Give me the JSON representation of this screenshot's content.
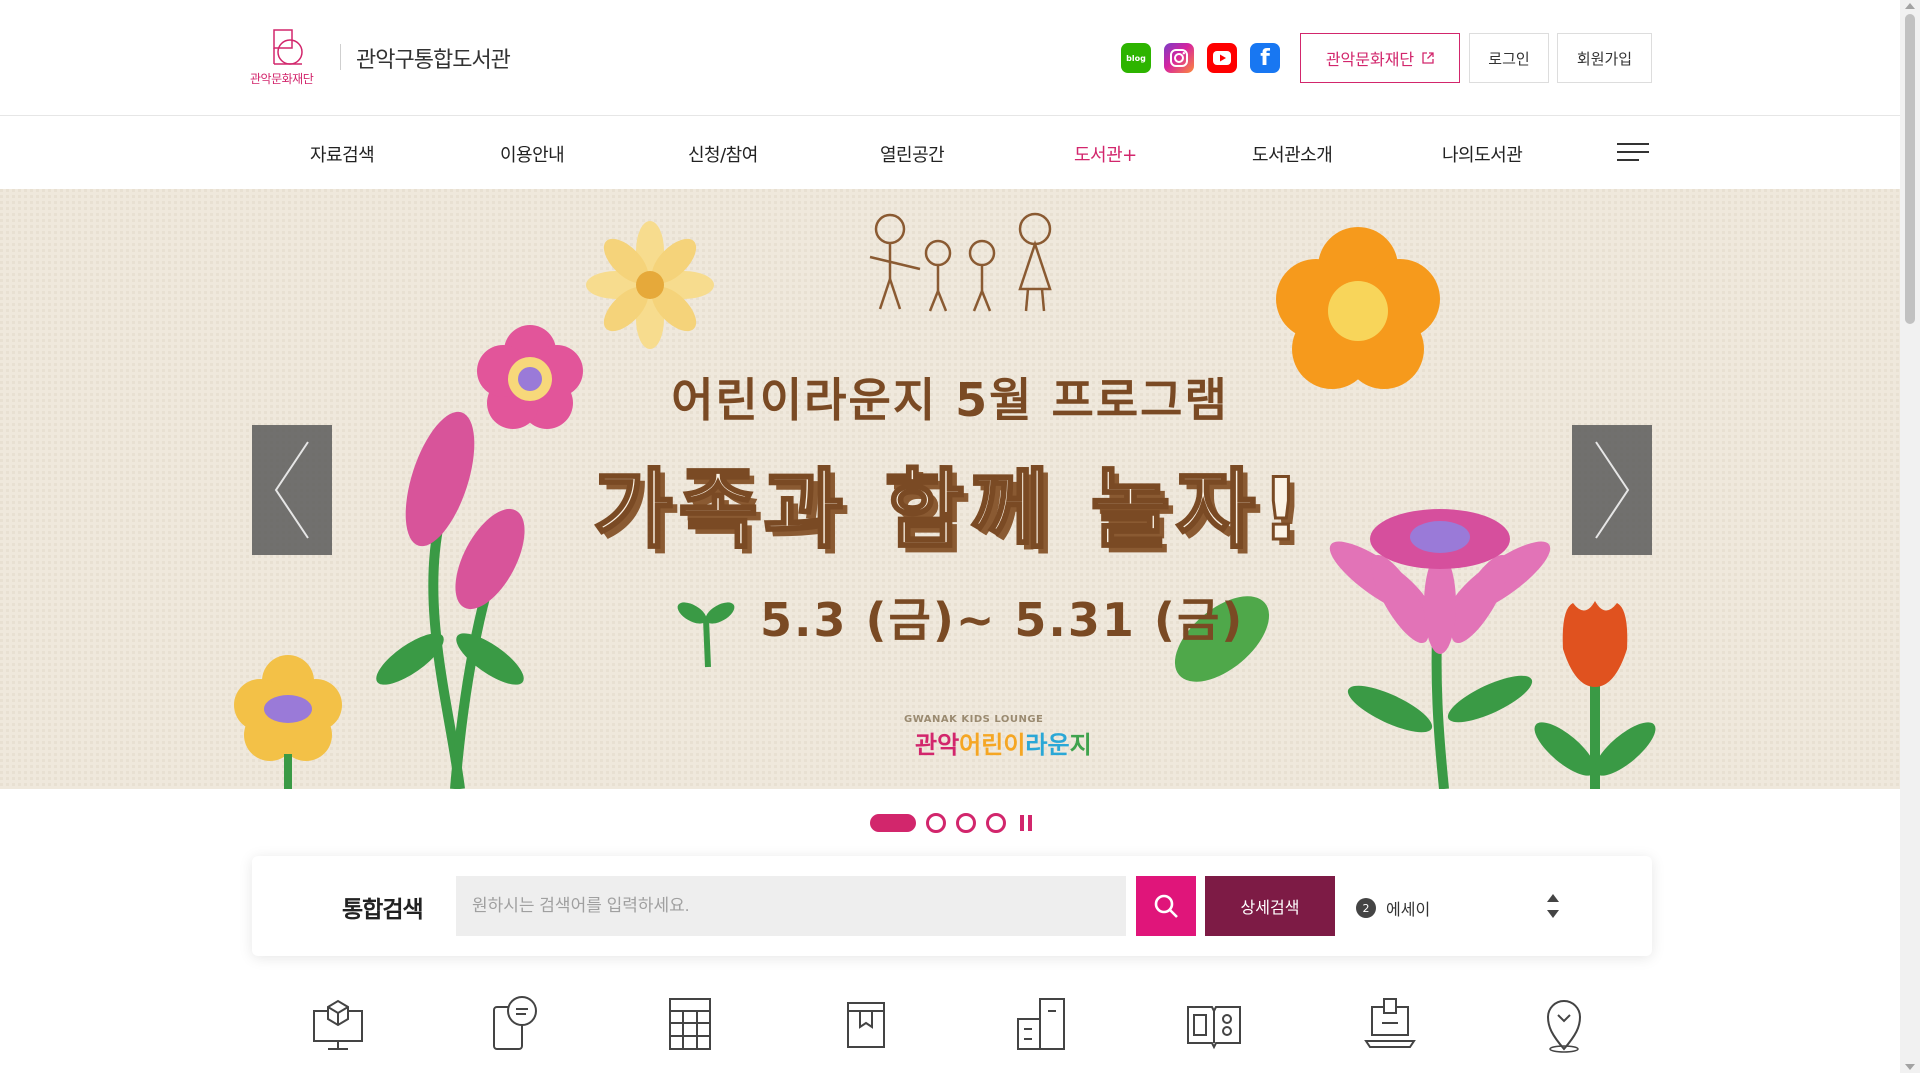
{
  "header": {
    "logo_text": "관악문화재단",
    "site_title": "관악구통합도서관",
    "sns": [
      {
        "name": "blog",
        "label": "blog",
        "color": "#2db400"
      },
      {
        "name": "instagram",
        "color": "#d6249f"
      },
      {
        "name": "youtube",
        "color": "#ff0000"
      },
      {
        "name": "facebook",
        "label": "f",
        "color": "#1877f2"
      }
    ],
    "foundation_button": "관악문화재단",
    "login": "로그인",
    "join": "회원가입"
  },
  "nav": {
    "items": [
      "자료검색",
      "이용안내",
      "신청/참여",
      "열린공간",
      "도서관+",
      "도서관소개",
      "나의도서관"
    ],
    "active_index": 4
  },
  "banner": {
    "subtitle": "어린이라운지 5월 프로그램",
    "title": "가족과 함께 놀자!",
    "date": "5.3 (금)~ 5.31 (금)",
    "brand_small": "GWANAK KIDS LOUNGE",
    "brand_parts": [
      "관악",
      "어린이",
      "라운",
      "지"
    ]
  },
  "pager": {
    "count": 4,
    "active": 0
  },
  "search": {
    "label": "통합검색",
    "placeholder": "원하시는 검색어를 입력하세요.",
    "advanced": "상세검색",
    "rank_number": "2",
    "rank_keyword": "에세이"
  },
  "quick_icons": [
    "monitor-box-icon",
    "phone-chat-icon",
    "shelf-icon",
    "book-icon",
    "building-icon",
    "open-book-icon",
    "laptop-icon",
    "location-pin-icon"
  ],
  "colors": {
    "accent": "#d2266c",
    "search_button": "#e0157a",
    "advanced_button": "#7d1b45"
  }
}
